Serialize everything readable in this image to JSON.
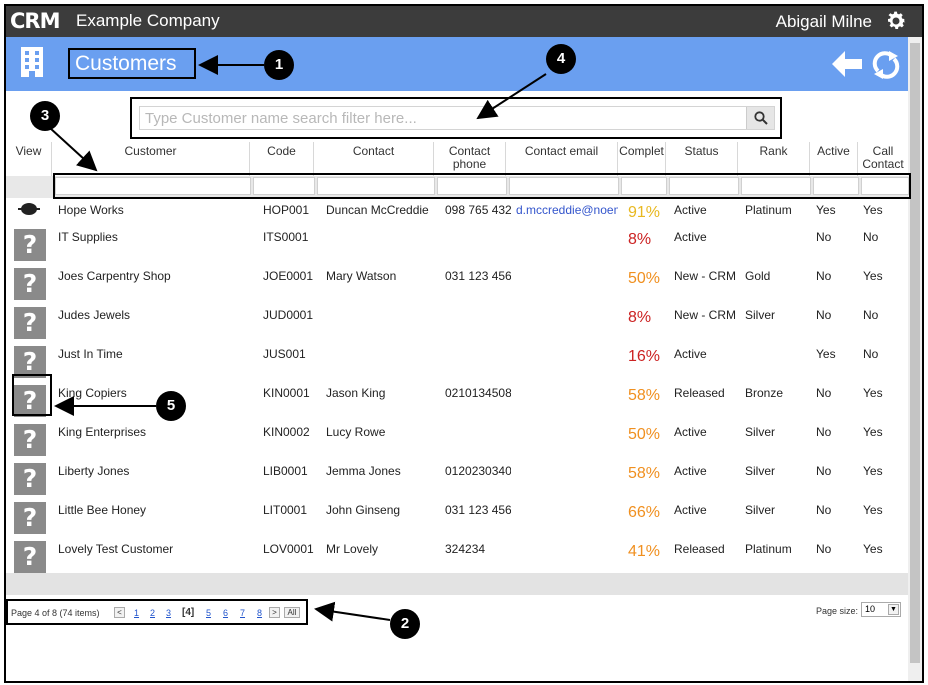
{
  "topbar": {
    "logo": "CRM",
    "company": "Example Company",
    "user": "Abigail Milne"
  },
  "page": {
    "title": "Customers"
  },
  "search": {
    "placeholder": "Type Customer name search filter here..."
  },
  "columns": [
    "View",
    "Customer",
    "Code",
    "Contact",
    "Contact phone",
    "Contact email",
    "Complet",
    "Status",
    "Rank",
    "Active",
    "Call Contact"
  ],
  "rows": [
    {
      "customer": "Hope Works",
      "code": "HOP001",
      "contact": "Duncan McCreddie",
      "phone": "098 765 432",
      "email": "d.mccreddie@noem",
      "pct": "91%",
      "pct_color": "#e8b820",
      "status": "Active",
      "rank": "Platinum",
      "active": "Yes",
      "call": "Yes",
      "icon": "logo-icon"
    },
    {
      "customer": "IT Supplies",
      "code": "ITS0001",
      "contact": "",
      "phone": "",
      "email": "",
      "pct": "8%",
      "pct_color": "#cc2222",
      "status": "Active",
      "rank": "",
      "active": "No",
      "call": "No",
      "icon": "question-icon"
    },
    {
      "customer": "Joes Carpentry Shop",
      "code": "JOE0001",
      "contact": "Mary Watson",
      "phone": "031 123 456",
      "email": "",
      "pct": "50%",
      "pct_color": "#f09020",
      "status": "New - CRM",
      "rank": "Gold",
      "active": "No",
      "call": "Yes",
      "icon": "question-icon"
    },
    {
      "customer": "Judes Jewels",
      "code": "JUD0001",
      "contact": "",
      "phone": "",
      "email": "",
      "pct": "8%",
      "pct_color": "#cc2222",
      "status": "New - CRM",
      "rank": "Silver",
      "active": "No",
      "call": "No",
      "icon": "question-icon"
    },
    {
      "customer": "Just In Time",
      "code": "JUS001",
      "contact": "",
      "phone": "",
      "email": "",
      "pct": "16%",
      "pct_color": "#cc2222",
      "status": "Active",
      "rank": "",
      "active": "Yes",
      "call": "No",
      "icon": "question-icon"
    },
    {
      "customer": "King Copiers",
      "code": "KIN0001",
      "contact": "Jason King",
      "phone": "0210134508",
      "email": "",
      "pct": "58%",
      "pct_color": "#f09020",
      "status": "Released",
      "rank": "Bronze",
      "active": "No",
      "call": "Yes",
      "icon": "question-icon"
    },
    {
      "customer": "King Enterprises",
      "code": "KIN0002",
      "contact": "Lucy Rowe",
      "phone": "",
      "email": "",
      "pct": "50%",
      "pct_color": "#f09020",
      "status": "Active",
      "rank": "Silver",
      "active": "No",
      "call": "Yes",
      "icon": "question-icon"
    },
    {
      "customer": "Liberty Jones",
      "code": "LIB0001",
      "contact": "Jemma Jones",
      "phone": "0120230340",
      "email": "",
      "pct": "58%",
      "pct_color": "#f09020",
      "status": "Active",
      "rank": "Silver",
      "active": "No",
      "call": "Yes",
      "icon": "question-icon"
    },
    {
      "customer": "Little Bee Honey",
      "code": "LIT0001",
      "contact": "John Ginseng",
      "phone": "031 123 456",
      "email": "",
      "pct": "66%",
      "pct_color": "#f09020",
      "status": "Active",
      "rank": "Silver",
      "active": "No",
      "call": "Yes",
      "icon": "question-icon"
    },
    {
      "customer": "Lovely Test Customer",
      "code": "LOV0001",
      "contact": "Mr Lovely",
      "phone": "324234",
      "email": "",
      "pct": "41%",
      "pct_color": "#f09020",
      "status": "Released",
      "rank": "Platinum",
      "active": "No",
      "call": "Yes",
      "icon": "question-icon"
    }
  ],
  "pager": {
    "summary": "Page 4 of 8 (74 items)",
    "prev": "<",
    "pages": [
      "1",
      "2",
      "3"
    ],
    "current": "[4]",
    "next_pages": [
      "5",
      "6",
      "7",
      "8"
    ],
    "next": ">",
    "all": "All",
    "page_size_label": "Page size:",
    "page_size": "10"
  },
  "callouts": [
    "1",
    "2",
    "3",
    "4",
    "5"
  ],
  "colors": {
    "topbar": "#3c3c3c",
    "header": "#6a9ff0",
    "question_icon": "#8a8a8a"
  }
}
